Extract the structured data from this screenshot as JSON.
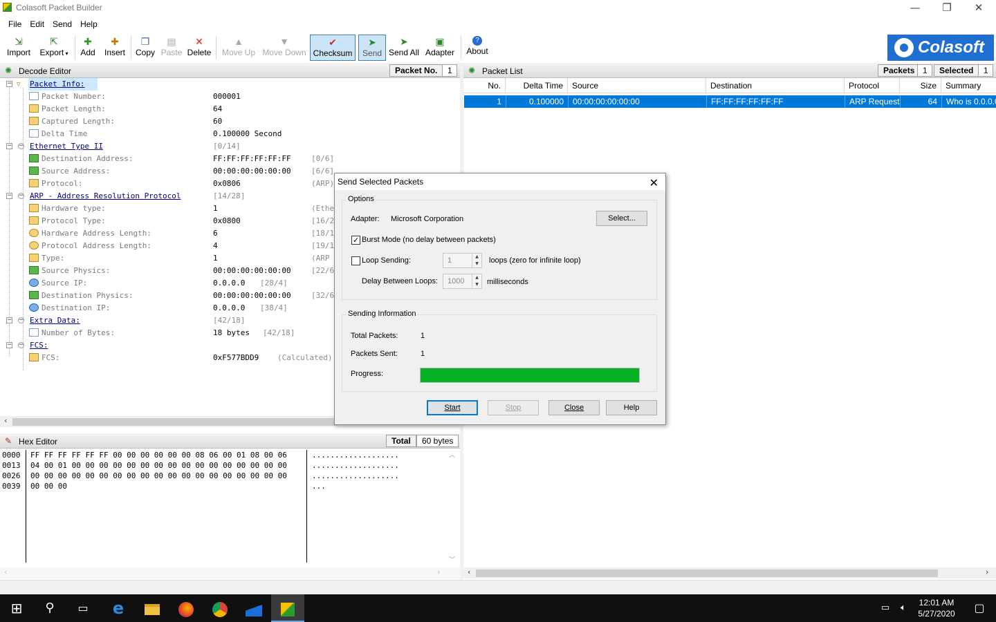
{
  "window": {
    "title": "Colasoft Packet Builder",
    "min": "—",
    "restore": "❐",
    "close": "✕"
  },
  "menu": [
    "File",
    "Edit",
    "Send",
    "Help"
  ],
  "toolbar": {
    "import": "Import",
    "export": "Export",
    "add": "Add",
    "insert": "Insert",
    "copy": "Copy",
    "paste": "Paste",
    "delete": "Delete",
    "move_up": "Move Up",
    "move_down": "Move Down",
    "checksum": "Checksum",
    "send": "Send",
    "send_all": "Send All",
    "adapter": "Adapter",
    "about": "About"
  },
  "logo": "Colasoft",
  "decode_editor": {
    "title": "Decode Editor",
    "packet_no_label": "Packet No.",
    "packet_no": "1",
    "rows": [
      {
        "label": "Packet Info:",
        "value": "",
        "extra": ""
      },
      {
        "label": "Packet Number:",
        "value": "000001",
        "extra": ""
      },
      {
        "label": "Packet Length:",
        "value": "64",
        "extra": ""
      },
      {
        "label": "Captured Length:",
        "value": "60",
        "extra": ""
      },
      {
        "label": "Delta Time",
        "value": "0.100000 Second",
        "extra": ""
      },
      {
        "label": "Ethernet Type II",
        "value": "[0/14]",
        "extra": ""
      },
      {
        "label": "Destination Address:",
        "value": "FF:FF:FF:FF:FF:FF",
        "extra": "[0/6]"
      },
      {
        "label": "Source Address:",
        "value": "00:00:00:00:00:00",
        "extra": "[6/6]"
      },
      {
        "label": "Protocol:",
        "value": "0x0806",
        "extra": "(ARP)"
      },
      {
        "label": "ARP - Address Resolution Protocol",
        "value": "[14/28]",
        "extra": ""
      },
      {
        "label": "Hardware type:",
        "value": "1",
        "extra": "(Ethe"
      },
      {
        "label": "Protocol Type:",
        "value": "0x0800",
        "extra": "[16/2"
      },
      {
        "label": "Hardware Address Length:",
        "value": "6",
        "extra": "[18/1"
      },
      {
        "label": "Protocol Address Length:",
        "value": "4",
        "extra": "[19/1"
      },
      {
        "label": "Type:",
        "value": "1",
        "extra": "(ARP"
      },
      {
        "label": "Source Physics:",
        "value": "00:00:00:00:00:00",
        "extra": "[22/6"
      },
      {
        "label": "Source IP:",
        "value": "0.0.0.0",
        "extra": "[28/4]"
      },
      {
        "label": "Destination Physics:",
        "value": "00:00:00:00:00:00",
        "extra": "[32/6"
      },
      {
        "label": "Destination IP:",
        "value": "0.0.0.0",
        "extra": "[38/4]"
      },
      {
        "label": "Extra Data:",
        "value": "[42/18]",
        "extra": ""
      },
      {
        "label": "Number of Bytes:",
        "value": "18 bytes",
        "extra": "[42/18]"
      },
      {
        "label": "FCS:",
        "value": "",
        "extra": ""
      },
      {
        "label": "FCS:",
        "value": "0xF577BDD9",
        "extra": "(Calculated)"
      }
    ]
  },
  "hex_editor": {
    "title": "Hex Editor",
    "total_label": "Total",
    "total_value": "60 bytes",
    "addresses": "0000\n0013\n0026\n0039",
    "bytes": "FF FF FF FF FF FF 00 00 00 00 00 00 08 06 00 01 08 00 06\n04 00 01 00 00 00 00 00 00 00 00 00 00 00 00 00 00 00 00\n00 00 00 00 00 00 00 00 00 00 00 00 00 00 00 00 00 00 00\n00 00 00",
    "ascii": "...................\n...................\n...................\n..."
  },
  "packet_list": {
    "title": "Packet List",
    "packets_label": "Packets",
    "packets_count": "1",
    "selected_label": "Selected",
    "selected_count": "1",
    "columns": [
      "No.",
      "Delta Time",
      "Source",
      "Destination",
      "Protocol",
      "Size",
      "Summary"
    ],
    "rows": [
      {
        "no": "1",
        "delta": "0.100000",
        "source": "00:00:00:00:00:00",
        "destination": "FF:FF:FF:FF:FF:FF",
        "protocol": "ARP Request",
        "size": "64",
        "summary": "Who is 0.0.0.0"
      }
    ]
  },
  "dialog": {
    "title": "Send Selected Packets",
    "options_label": "Options",
    "adapter_label": "Adapter:",
    "adapter_value": "Microsoft Corporation",
    "select_button": "Select...",
    "burst_label": "Burst Mode (no delay between packets)",
    "burst_checked": true,
    "loop_label": "Loop Sending:",
    "loop_checked": false,
    "loop_value": "1",
    "loop_hint": "loops (zero for infinite loop)",
    "delay_label": "Delay Between Loops:",
    "delay_value": "1000",
    "delay_unit": "milliseconds",
    "info_label": "Sending Information",
    "total_packets_label": "Total Packets:",
    "total_packets": "1",
    "packets_sent_label": "Packets Sent:",
    "packets_sent": "1",
    "progress_label": "Progress:",
    "progress": 1.0,
    "progress_color": "#06b025",
    "start": "Start",
    "stop": "Stop",
    "close": "Close",
    "help": "Help"
  },
  "taskbar": {
    "time": "12:01 AM",
    "date": "5/27/2020",
    "icons": [
      "windows-start-icon",
      "search-icon",
      "task-view-icon",
      "edge-icon",
      "file-explorer-icon",
      "firefox-icon",
      "chrome-icon",
      "wireshark-icon",
      "packet-builder-icon"
    ]
  },
  "colors": {
    "selection": "#0078d7",
    "accent": "#1f6fd0",
    "section_link": "#00008b"
  }
}
